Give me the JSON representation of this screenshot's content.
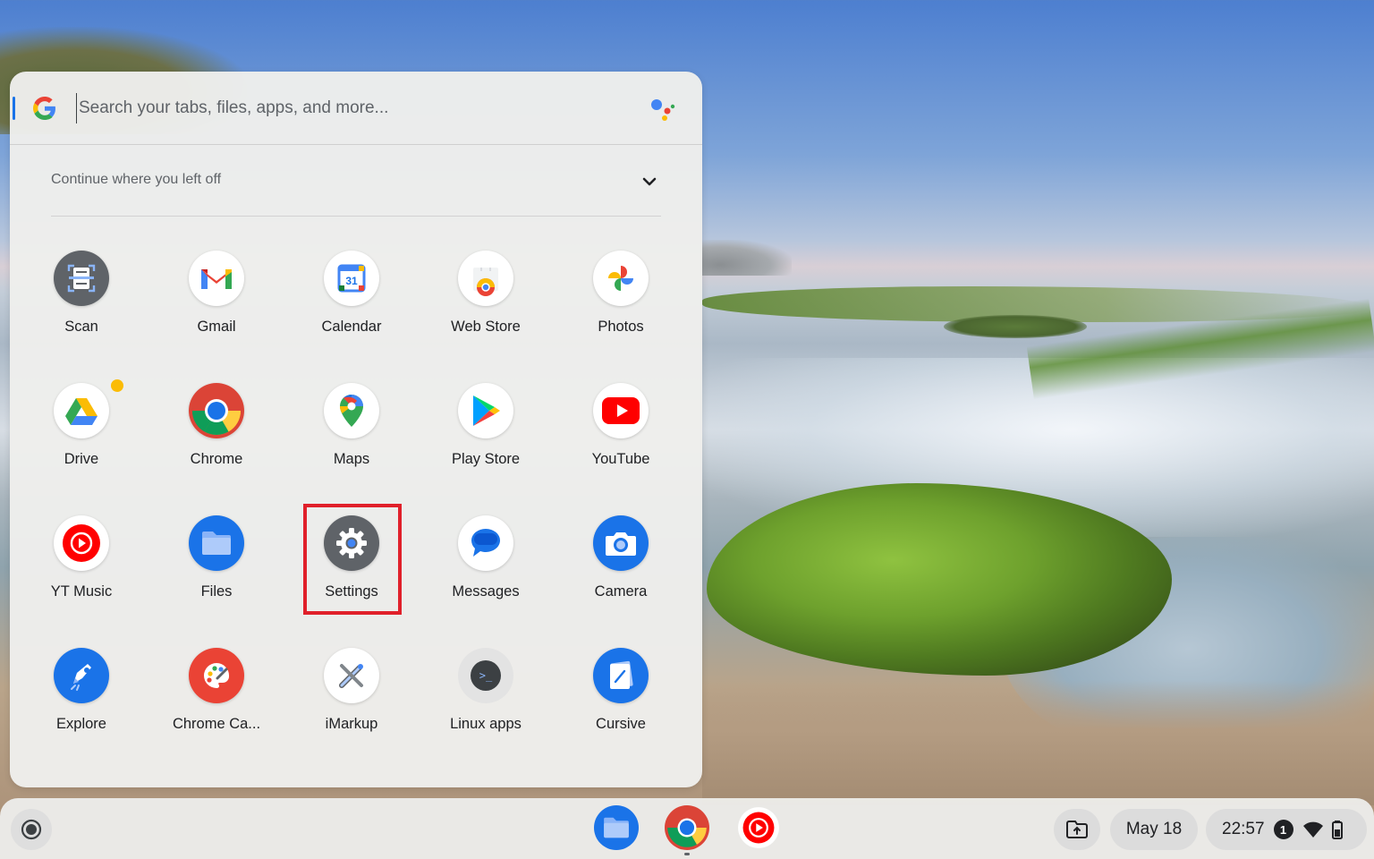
{
  "search": {
    "placeholder": "Search your tabs, files, apps, and more..."
  },
  "continue_section": {
    "label": "Continue where you left off"
  },
  "apps": [
    {
      "name": "Scan",
      "icon": "scan-icon"
    },
    {
      "name": "Gmail",
      "icon": "gmail-icon"
    },
    {
      "name": "Calendar",
      "icon": "calendar-icon",
      "icon_text": "31"
    },
    {
      "name": "Web Store",
      "icon": "web-store-icon"
    },
    {
      "name": "Photos",
      "icon": "photos-icon"
    },
    {
      "name": "Drive",
      "icon": "drive-icon"
    },
    {
      "name": "Chrome",
      "icon": "chrome-icon"
    },
    {
      "name": "Maps",
      "icon": "maps-icon"
    },
    {
      "name": "Play Store",
      "icon": "play-store-icon"
    },
    {
      "name": "YouTube",
      "icon": "youtube-icon"
    },
    {
      "name": "YT Music",
      "icon": "yt-music-icon"
    },
    {
      "name": "Files",
      "icon": "files-icon"
    },
    {
      "name": "Settings",
      "icon": "settings-icon"
    },
    {
      "name": "Messages",
      "icon": "messages-icon"
    },
    {
      "name": "Camera",
      "icon": "camera-icon"
    },
    {
      "name": "Explore",
      "icon": "explore-icon"
    },
    {
      "name": "Chrome Ca...",
      "icon": "chrome-canvas-icon"
    },
    {
      "name": "iMarkup",
      "icon": "imarkup-icon"
    },
    {
      "name": "Linux apps",
      "icon": "terminal-icon",
      "icon_text": ">_"
    },
    {
      "name": "Cursive",
      "icon": "cursive-icon"
    }
  ],
  "shelf": {
    "pinned": [
      "files-icon",
      "chrome-icon",
      "yt-music-icon"
    ],
    "date": "May 18",
    "time": "22:57",
    "notification_count": "1"
  },
  "colors": {
    "highlight": "#e0202a",
    "google_blue": "#1a73e8"
  }
}
